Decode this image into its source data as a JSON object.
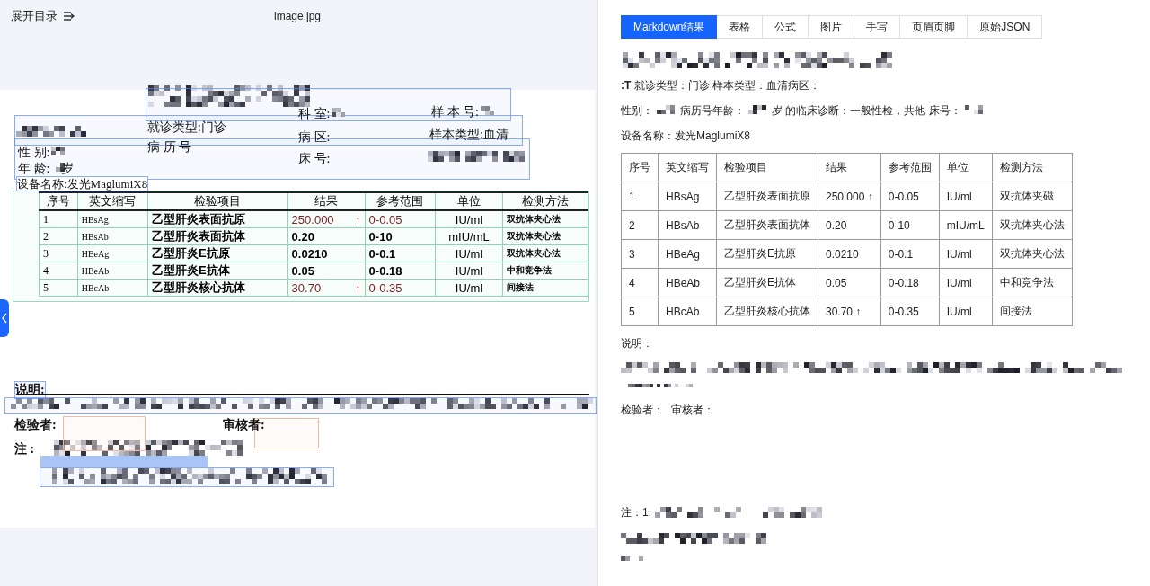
{
  "viewer": {
    "toc_label": "展开目录",
    "file_name": "image.jpg"
  },
  "document": {
    "fields": [
      {
        "text": "就诊类型:门诊",
        "redacted_after": false
      },
      {
        "text": "科 室:",
        "redacted_after": true
      },
      {
        "text": "样 本 号:",
        "redacted_after": true
      },
      {
        "text": "病 历 号",
        "redacted_after": false
      },
      {
        "text": "病 区:",
        "redacted_after": false
      },
      {
        "text": "样本类型:血清",
        "redacted_after": false
      },
      {
        "text": "性 别:",
        "redacted_after": true
      },
      {
        "text": "年 龄:",
        "redacted_after": true
      },
      {
        "text": "岁",
        "redacted_after": false
      },
      {
        "text": "床 号:",
        "redacted_after": false
      }
    ],
    "device": "设备名称:发光MaglumiX8",
    "table": {
      "columns": [
        "序号",
        "英文缩写",
        "检验项目",
        "结果",
        "参考范围",
        "单位",
        "检测方法"
      ],
      "rows": [
        {
          "no": "1",
          "abbr": "HBsAg",
          "item": "乙型肝炎表面抗原",
          "result": "250.000",
          "flag": "↑",
          "abnormal": true,
          "range": "0-0.05",
          "unit": "IU/ml",
          "method": "双抗体夹心法"
        },
        {
          "no": "2",
          "abbr": "HBsAb",
          "item": "乙型肝炎表面抗体",
          "result": "0.20",
          "abnormal": false,
          "range": "0-10",
          "unit": "mIU/mL",
          "method": "双抗体夹心法"
        },
        {
          "no": "3",
          "abbr": "HBeAg",
          "item": "乙型肝炎E抗原",
          "result": "0.0210",
          "abnormal": false,
          "range": "0-0.1",
          "unit": "IU/ml",
          "method": "双抗体夹心法"
        },
        {
          "no": "4",
          "abbr": "HBeAb",
          "item": "乙型肝炎E抗体",
          "result": "0.05",
          "abnormal": false,
          "range": "0-0.18",
          "unit": "IU/ml",
          "method": "中和竞争法"
        },
        {
          "no": "5",
          "abbr": "HBcAb",
          "item": "乙型肝炎核心抗体",
          "result": "30.70",
          "flag": "↑",
          "abnormal": true,
          "range": "0-0.35",
          "unit": "IU/ml",
          "method": "间接法"
        }
      ]
    },
    "note_label": "说明:",
    "inspector_label": "检验者:",
    "reviewer_label": "审核者:",
    "remark_label": "注 :"
  },
  "result": {
    "tabs": [
      {
        "label": "Markdown结果",
        "selected": true
      },
      {
        "label": "表格",
        "selected": false
      },
      {
        "label": "公式",
        "selected": false
      },
      {
        "label": "图片",
        "selected": false
      },
      {
        "label": "手写",
        "selected": false
      },
      {
        "label": "页眉页脚",
        "selected": false
      },
      {
        "label": "原始JSON",
        "selected": false
      }
    ],
    "lines": [
      {
        "parts": [
          {
            "text": "**:T** 就诊类型：门诊 样本类型：血清病区：",
            "redacted_after": false
          }
        ]
      },
      {
        "parts": [
          {
            "text": "性别：",
            "redacted_after": true
          },
          {
            "text": "病历号年龄：",
            "redacted_after": true
          },
          {
            "text": "岁 的临床诊断：一般性检，共他 床号：",
            "redacted_after": true
          }
        ]
      },
      {
        "parts": [
          {
            "text": "设备名称：发光MaglumiX8",
            "redacted_after": false
          }
        ]
      }
    ],
    "table": {
      "columns": [
        "序号",
        "英文缩写",
        "检验项目",
        "结果",
        "参考范围",
        "单位",
        "检测方法"
      ],
      "rows": [
        [
          "1",
          "HBsAg",
          "乙型肝炎表面抗原",
          "250.000 ↑",
          "0-0.05",
          "IU/ml",
          "双抗体夹磁"
        ],
        [
          "2",
          "HBsAb",
          "乙型肝炎表面抗体",
          "0.20",
          "0-10",
          "mIU/mL",
          "双抗体夹心法"
        ],
        [
          "3",
          "HBeAg",
          "乙型肝炎E抗原",
          "0.0210",
          "0-0.1",
          "IU/ml",
          "双抗体夹心法"
        ],
        [
          "4",
          "HBeAb",
          "乙型肝炎E抗体",
          "0.05",
          "0-0.18",
          "IU/ml",
          "中和竞争法"
        ],
        [
          "5",
          "HBcAb",
          "乙型肝炎核心抗体",
          "30.70 ↑",
          "0-0.35",
          "IU/ml",
          "间接法"
        ]
      ]
    },
    "note_label": "说明：",
    "inspector_label": "检验者：",
    "reviewer_label": "审核者：",
    "remark_label": "注：1."
  }
}
